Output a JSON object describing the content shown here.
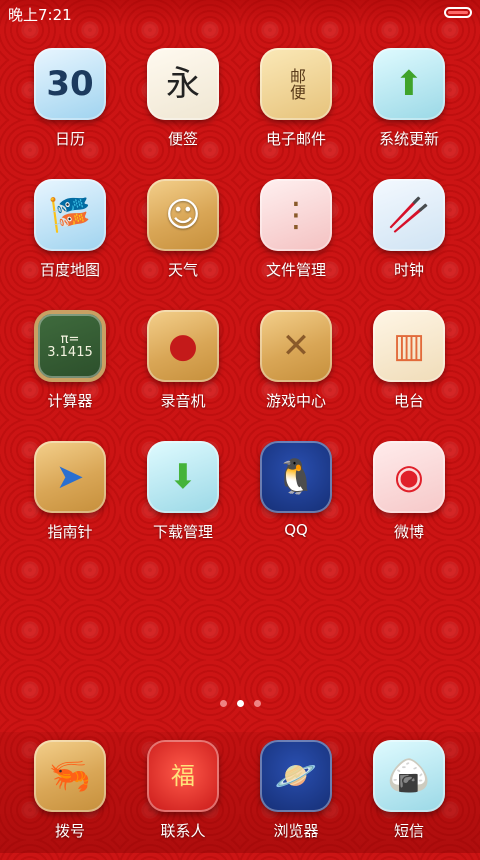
{
  "status_bar": {
    "time": "晚上7:21"
  },
  "apps": [
    {
      "label": "日历",
      "icon": "calendar-icon",
      "glyph": "30"
    },
    {
      "label": "便签",
      "icon": "notes-icon",
      "glyph": "永"
    },
    {
      "label": "电子邮件",
      "icon": "mail-icon",
      "glyph": "邮便"
    },
    {
      "label": "系统更新",
      "icon": "update-arrow-icon",
      "glyph": "⬆"
    },
    {
      "label": "百度地图",
      "icon": "carp-fish-icon",
      "glyph": "🎏"
    },
    {
      "label": "天气",
      "icon": "teru-teru-doll-icon",
      "glyph": "☺"
    },
    {
      "label": "文件管理",
      "icon": "folder-icon",
      "glyph": "⋮"
    },
    {
      "label": "时钟",
      "icon": "chopsticks-icon",
      "glyph": "🥢"
    },
    {
      "label": "计算器",
      "icon": "chalkboard-icon",
      "glyph": "π=\n3.1415"
    },
    {
      "label": "录音机",
      "icon": "record-button-icon",
      "glyph": "●"
    },
    {
      "label": "游戏中心",
      "icon": "toy-icon",
      "glyph": "✕"
    },
    {
      "label": "电台",
      "icon": "radio-icon",
      "glyph": "▥"
    },
    {
      "label": "指南针",
      "icon": "compass-icon",
      "glyph": "➤"
    },
    {
      "label": "下载管理",
      "icon": "download-icon",
      "glyph": "⬇"
    },
    {
      "label": "QQ",
      "icon": "penguin-icon",
      "glyph": "🐧"
    },
    {
      "label": "微博",
      "icon": "weibo-icon",
      "glyph": "◉"
    }
  ],
  "dock": [
    {
      "label": "拨号",
      "icon": "phone-shrimp-icon",
      "glyph": "🦐"
    },
    {
      "label": "联系人",
      "icon": "daruma-icon",
      "glyph": "福"
    },
    {
      "label": "浏览器",
      "icon": "planet-icon",
      "glyph": "🪐"
    },
    {
      "label": "短信",
      "icon": "sushi-icon",
      "glyph": "🍙"
    }
  ],
  "pager": {
    "count": 3,
    "active_index": 1
  }
}
